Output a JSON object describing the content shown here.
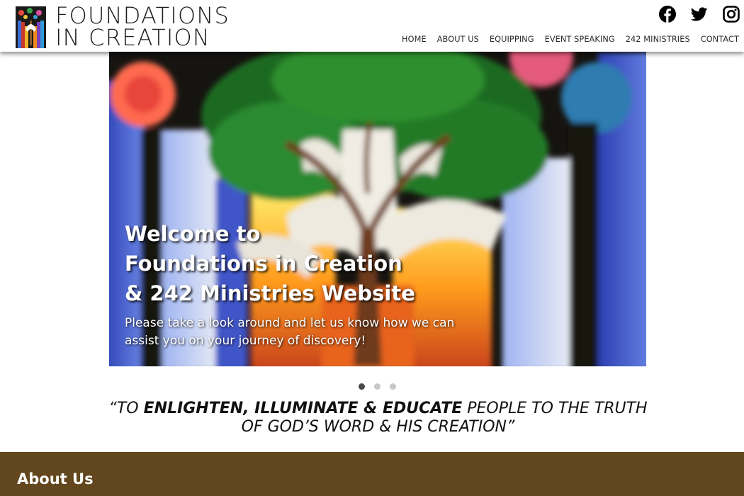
{
  "header": {
    "logo": {
      "line1": "FOUNDATIONS",
      "line2": "IN CREATION"
    },
    "social": [
      {
        "name": "facebook-icon"
      },
      {
        "name": "twitter-icon"
      },
      {
        "name": "instagram-icon"
      }
    ],
    "nav": [
      {
        "label": "HOME"
      },
      {
        "label": "ABOUT US"
      },
      {
        "label": "EQUIPPING"
      },
      {
        "label": "EVENT SPEAKING"
      },
      {
        "label": "242 MINISTRIES"
      },
      {
        "label": "CONTACT"
      }
    ]
  },
  "hero": {
    "title_line1": "Welcome to",
    "title_line2": "Foundations in Creation",
    "title_line3": "& 242 Ministries Website",
    "subtitle": "Please take a look around and let us know how we can assist you on your journey of discovery!"
  },
  "carousel": {
    "slide_count": 3,
    "active_index": 0
  },
  "slogan": {
    "part1": "“TO ",
    "emphasis": "ENLIGHTEN, ILLUMINATE & EDUCATE",
    "part2": " PEOPLE TO THE TRUTH",
    "line2": "OF GOD’S WORD & HIS CREATION”"
  },
  "about": {
    "heading": "About Us"
  },
  "colors": {
    "about_bg": "#62461d",
    "active_dot": "#4a4a4a",
    "inactive_dot": "#c8c8c8"
  }
}
